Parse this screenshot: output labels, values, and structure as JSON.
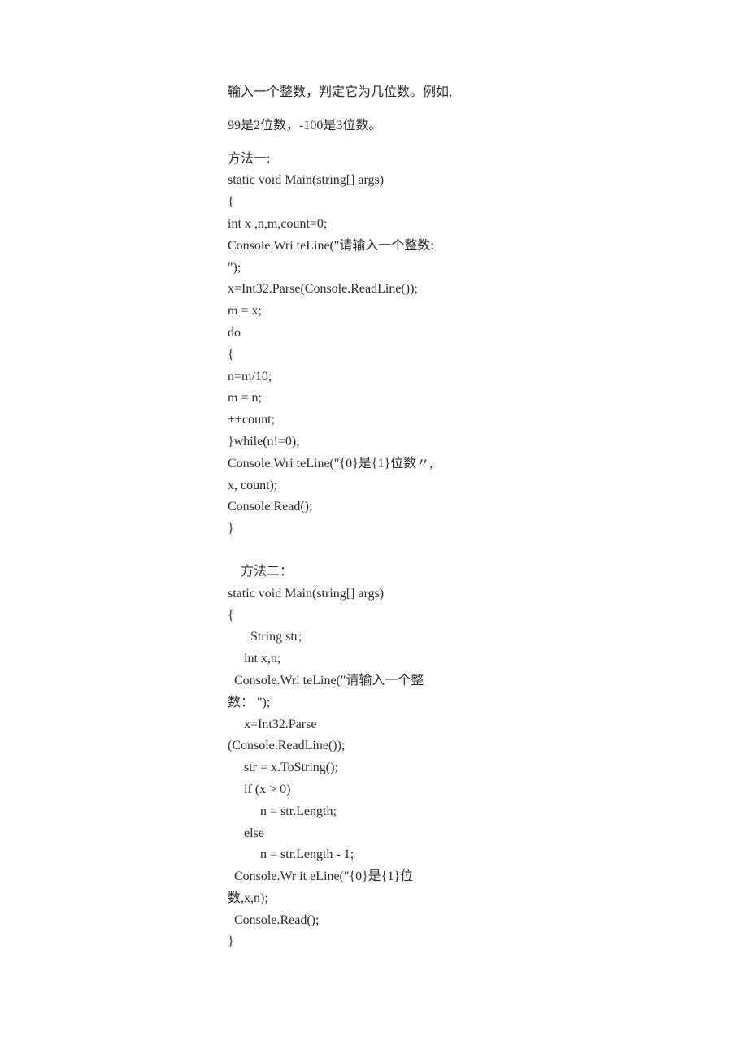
{
  "doc": {
    "problem_line1": "输入一个整数，判定它为几位数。例如,",
    "problem_line2": "99是2位数，-100是3位数。",
    "method1_label": "方法一:",
    "method1_code": [
      "static void Main(string[] args)",
      "{",
      "int x ,n,m,count=0;",
      "Console.Wri teLine(\"请输入一个整数:",
      "\");",
      "x=Int32.Parse(Console.ReadLine());",
      "m = x;",
      "do",
      "{",
      "n=m/10;",
      "m = n;",
      "++count;",
      "}while(n!=0);",
      "Console.Wri teLine(\"{0}是{1}位数〃,",
      "x, count);",
      "Console.Read();",
      "}"
    ],
    "method2_label": "    方法二：",
    "method2_code": [
      "static void Main(string[] args)",
      "{",
      "       String str;",
      "     int x,n;",
      "  Console.Wri teLine(\"请输入一个整",
      "数： \");",
      "     x=Int32.Parse",
      "(Console.ReadLine());",
      "     str = x.ToString();",
      "     if (x > 0)",
      "          n = str.Length;",
      "",
      "     else",
      "          n = str.Length - 1;",
      "",
      "  Console.Wr it eLine(\"{0}是{1}位",
      "数,x,n);",
      "  Console.Read();",
      "}"
    ]
  }
}
